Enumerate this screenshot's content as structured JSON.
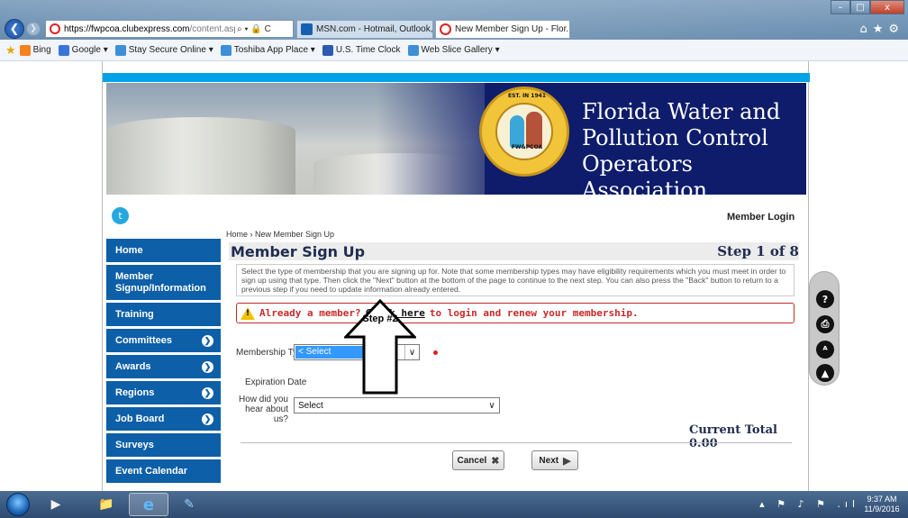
{
  "browser": {
    "url_domain": "https://fwpcoa.clubexpress.com",
    "url_rest": "/content.aspx?page",
    "addr_tools": "⌕ ▾ 🔒 C",
    "tabs": [
      {
        "label": "MSN.com - Hotmail, Outlook, ...",
        "icon": "msn-icon"
      },
      {
        "label": "New Member Sign Up - Flor...",
        "icon": "clubexpress-icon",
        "close": "×"
      }
    ],
    "window_controls": {
      "minimize": "–",
      "maximize": "□",
      "close": "x"
    },
    "right_icons": "⌂★⚙",
    "favorites": [
      {
        "label": "Bing",
        "icon": "bing-icon",
        "color": "#f58220"
      },
      {
        "label": "Google",
        "icon": "google-icon",
        "color": "#3b73d8",
        "dropdown": "▾"
      },
      {
        "label": "Stay Secure Online",
        "icon": "ie-page-icon",
        "color": "#3d8fd6",
        "dropdown": "▾"
      },
      {
        "label": "Toshiba App Place",
        "icon": "ie-page-icon",
        "color": "#3d8fd6",
        "dropdown": "▾"
      },
      {
        "label": "U.S. Time Clock",
        "icon": "flag-icon",
        "color": "#2d5bb0"
      },
      {
        "label": "Web Slice Gallery",
        "icon": "ie-page-icon",
        "color": "#3d8fd6",
        "dropdown": "▾"
      }
    ]
  },
  "banner": {
    "org_name": "Florida Water and Pollution Control Operators Association",
    "seal_top": "EST. IN 1941",
    "seal_abbr": "FW&PCOA"
  },
  "header": {
    "twitter": "t",
    "member_login": "Member Login"
  },
  "sidenav": {
    "items": [
      {
        "label": "Home",
        "has_arrow": false
      },
      {
        "label": "Member Signup/Information",
        "has_arrow": false
      },
      {
        "label": "Training",
        "has_arrow": false
      },
      {
        "label": "Committees",
        "has_arrow": true
      },
      {
        "label": "Awards",
        "has_arrow": true
      },
      {
        "label": "Regions",
        "has_arrow": true
      },
      {
        "label": "Job Board",
        "has_arrow": true
      },
      {
        "label": "Surveys",
        "has_arrow": false
      },
      {
        "label": "Event Calendar",
        "has_arrow": false
      }
    ],
    "arrow_glyph": "❯"
  },
  "main": {
    "breadcrumb": "Home  ›  New Member Sign Up",
    "title": "Member Sign Up",
    "step": "Step 1 of 8",
    "instructions": "Select the type of membership that you are signing up for. Note that some membership types may have eligibility requirements which you must meet in order to sign up using that type. Then click the \"Next\" button at the bottom of the page to continue to the next step. You can also press the \"Back\" button to return to a previous step if you need to update information already entered.",
    "already_member_prefix": "Already a member?",
    "click_here": "Click here",
    "already_member_suffix": "to login and renew your membership.",
    "membership_type_label": "Membership Type",
    "membership_type_value": "< Select",
    "expiration_label": "Expiration Date",
    "hear_label": "How did you hear about us?",
    "hear_value": "Select",
    "current_total": "Current Total 0.00",
    "cancel_label": "Cancel",
    "next_label": "Next",
    "annotation": "Step #2"
  },
  "float_toolbar": [
    "?",
    "⎙",
    "ᴬ",
    "▲"
  ],
  "taskbar": {
    "tray": "▴ ⚑ ♪ ⚑ .ıl",
    "time": "9:37 AM",
    "date": "11/9/2016"
  },
  "colors": {
    "nav_blue": "#0d5fa8",
    "banner_navy": "#0e1c6b",
    "accent_cyan": "#00a3e8",
    "alert_red": "#c62a2a"
  }
}
